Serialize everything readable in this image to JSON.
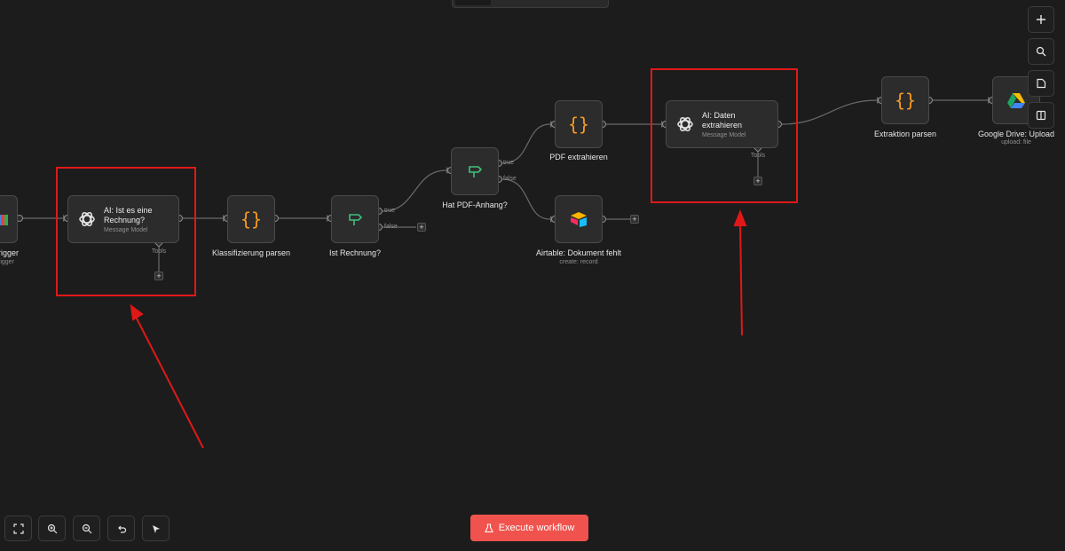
{
  "nodes": {
    "trigger": {
      "label": "rigger",
      "sublabel": "rigger"
    },
    "ai_classify": {
      "title": "AI: Ist es eine\nRechnung?",
      "subtitle": "Message Model",
      "tools": "Tools"
    },
    "parse_classification": {
      "label": "Klassifizierung parsen"
    },
    "is_invoice": {
      "label": "Ist Rechnung?",
      "true_label": "true",
      "false_label": "false"
    },
    "has_pdf": {
      "label": "Hat PDF-Anhang?",
      "true_label": "true",
      "false_label": "false"
    },
    "extract_pdf": {
      "label": "PDF extrahieren"
    },
    "airtable": {
      "label": "Airtable: Dokument fehlt",
      "sublabel": "create: record"
    },
    "ai_extract": {
      "title": "AI: Daten\nextrahieren",
      "subtitle": "Message Model",
      "tools": "Tools"
    },
    "parse_extraction": {
      "label": "Extraktion parsen"
    },
    "gdrive": {
      "label": "Google Drive: Upload",
      "sublabel": "upload: file"
    }
  },
  "plus_symbol": "+",
  "execute_button": {
    "label": "Execute workflow"
  },
  "colors": {
    "background": "#1c1c1c",
    "node_bg": "#2c2c2c",
    "highlight": "#e01818",
    "execute": "#f0534d",
    "code_icon": "#f59a23",
    "if_icon": "#3ec17c"
  },
  "icons": {
    "sidebar": [
      "plus-icon",
      "search-icon",
      "sticky-note-icon",
      "panel-icon"
    ],
    "bottom": [
      "fit-view-icon",
      "zoom-in-icon",
      "zoom-out-icon",
      "undo-icon",
      "clean-up-icon"
    ]
  }
}
